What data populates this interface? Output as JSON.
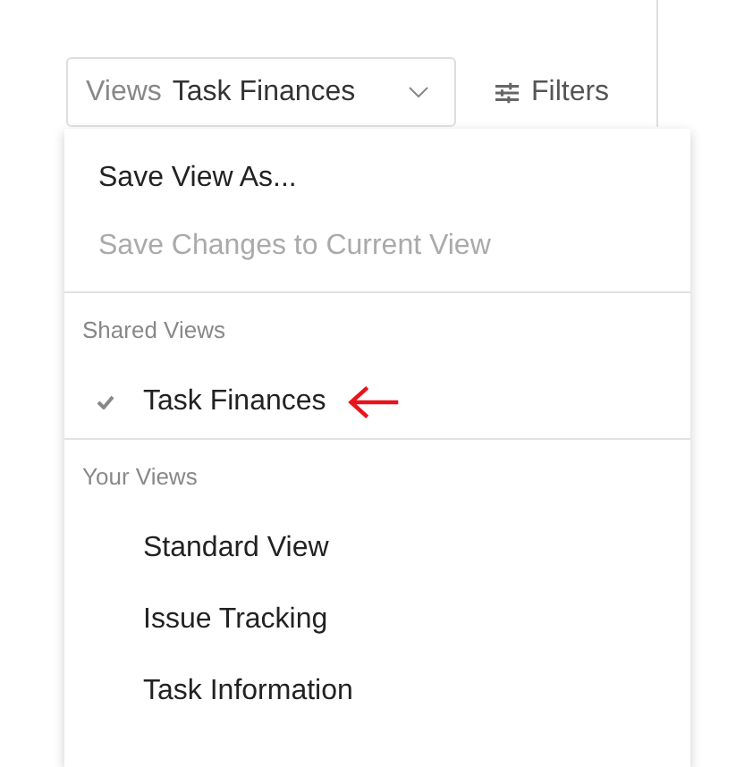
{
  "toolbar": {
    "views_label": "Views",
    "current_view": "Task Finances",
    "filters_label": "Filters"
  },
  "menu": {
    "actions": [
      {
        "label": "Save View As...",
        "disabled": false
      },
      {
        "label": "Save Changes to Current View",
        "disabled": true
      }
    ],
    "sections": [
      {
        "title": "Shared Views",
        "items": [
          {
            "label": "Task Finances",
            "selected": true,
            "arrow_marked": true
          }
        ]
      },
      {
        "title": "Your Views",
        "items": [
          {
            "label": "Standard View",
            "selected": false,
            "arrow_marked": false
          },
          {
            "label": "Issue Tracking",
            "selected": false,
            "arrow_marked": false
          },
          {
            "label": "Task Information",
            "selected": false,
            "arrow_marked": false
          }
        ]
      }
    ]
  }
}
